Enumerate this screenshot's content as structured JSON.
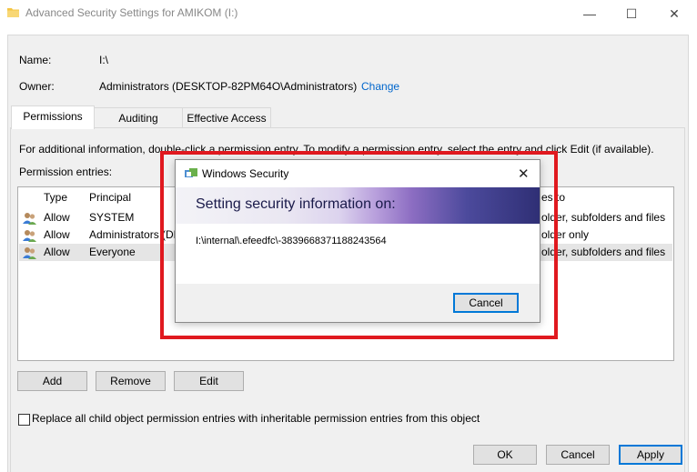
{
  "window": {
    "title": "Advanced Security Settings for AMIKOM (I:)",
    "controls": {
      "minimize": "—",
      "maximize": "☐",
      "close": "✕"
    }
  },
  "info": {
    "name_label": "Name:",
    "name_value": "I:\\",
    "owner_label": "Owner:",
    "owner_value": "Administrators (DESKTOP-82PM64O\\Administrators)",
    "change_link": "Change"
  },
  "tabs": [
    {
      "label": "Permissions",
      "active": true
    },
    {
      "label": "Auditing",
      "active": false
    },
    {
      "label": "Effective Access",
      "active": false
    }
  ],
  "panel": {
    "info_text": "For additional information, double-click a permission entry. To modify a permission entry, select the entry and click Edit (if available).",
    "entries_label": "Permission entries:"
  },
  "table": {
    "columns": [
      "Type",
      "Principal",
      "Applies to"
    ],
    "rows": [
      {
        "type": "Allow",
        "principal": "SYSTEM",
        "applies_to": "This folder, subfolders and files"
      },
      {
        "type": "Allow",
        "principal": "Administrators (DESKTOP-82PM64O\\Administrators)",
        "applies_to": "This folder only"
      },
      {
        "type": "Allow",
        "principal": "Everyone",
        "applies_to": "This folder, subfolders and files"
      }
    ],
    "visible": {
      "applies_header_tail": "es to",
      "applies": [
        "older, subfolders and files",
        "older only",
        "older, subfolders and files"
      ],
      "principal_row2": "Administrators (DE"
    }
  },
  "buttons": {
    "add": "Add",
    "remove": "Remove",
    "edit": "Edit",
    "ok": "OK",
    "cancel": "Cancel",
    "apply": "Apply"
  },
  "checkbox": {
    "label": "Replace all child object permission entries with inheritable permission entries from this object",
    "checked": false
  },
  "dialog": {
    "title": "Windows Security",
    "heading": "Setting security information on:",
    "path": "I:\\internal\\.efeedfc\\-3839668371188243564",
    "cancel_label": "Cancel",
    "close_glyph": "✕"
  },
  "colors": {
    "highlight_border": "#e0191f",
    "link": "#0066cc",
    "primary_button_border": "#0078d7"
  },
  "icons": [
    "folder-icon",
    "users-icon",
    "shield-icon",
    "close-icon"
  ]
}
